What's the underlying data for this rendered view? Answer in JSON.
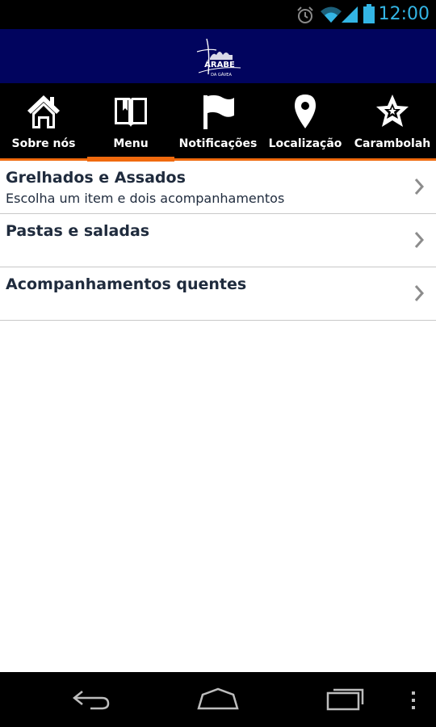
{
  "status_bar": {
    "time": "12:00",
    "icons": [
      "alarm-icon",
      "wifi-icon",
      "signal-icon",
      "battery-icon"
    ]
  },
  "header": {
    "logo": "arabe-da-gavea-logo",
    "logo_text": "ÁRABE",
    "logo_subtext": "DA GÁVEA"
  },
  "tabs": [
    {
      "label": "Sobre nós",
      "icon": "home-icon",
      "active": false
    },
    {
      "label": "Menu",
      "icon": "book-icon",
      "active": true
    },
    {
      "label": "Notificações",
      "icon": "flag-icon",
      "active": false
    },
    {
      "label": "Localização",
      "icon": "location-pin-icon",
      "active": false
    },
    {
      "label": "Carambolah",
      "icon": "star-icon",
      "active": false
    }
  ],
  "accent_color": "#f06a0e",
  "header_color": "#01045e",
  "menu_items": [
    {
      "title": "Grelhados e Assados",
      "subtitle": "Escolha um item e dois acompanhamentos"
    },
    {
      "title": "Pastas e saladas",
      "subtitle": ""
    },
    {
      "title": "Acompanhamentos quentes",
      "subtitle": ""
    }
  ],
  "nav_bar": {
    "buttons": [
      "back-icon",
      "home-nav-icon",
      "recent-apps-icon",
      "overflow-menu-icon"
    ]
  }
}
